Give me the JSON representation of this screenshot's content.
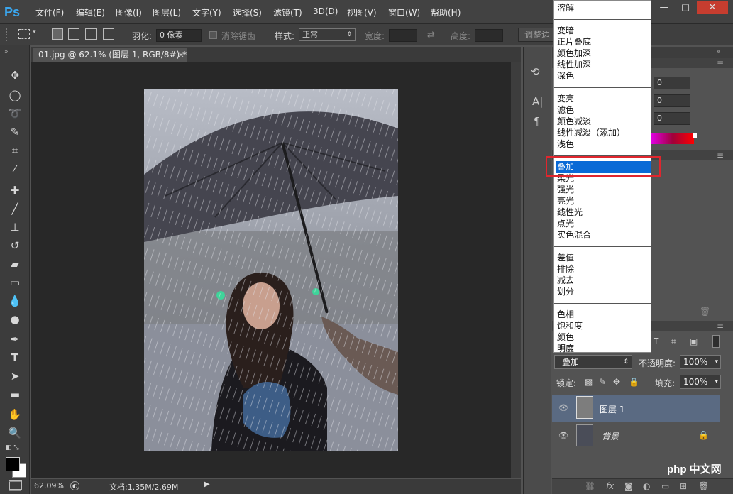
{
  "app": {
    "logo": "Ps"
  },
  "menu": [
    "文件(F)",
    "编辑(E)",
    "图像(I)",
    "图层(L)",
    "文字(Y)",
    "选择(S)",
    "滤镜(T)",
    "3D(D)",
    "视图(V)",
    "窗口(W)",
    "帮助(H)"
  ],
  "options": {
    "feather_label": "羽化:",
    "feather_value": "0 像素",
    "antialias_label": "消除锯齿",
    "style_label": "样式:",
    "style_value": "正常",
    "width_label": "宽度:",
    "height_label": "高度:",
    "refine_button": "调整边"
  },
  "document": {
    "tab_title": "01.jpg @ 62.1% (图层 1, RGB/8#) *",
    "tab_close": "×"
  },
  "status": {
    "zoom": "62.09%",
    "doc_info": "文档:1.35M/2.69M"
  },
  "properties": {
    "values": [
      "0",
      "0",
      "0"
    ]
  },
  "blend_dropdown": {
    "groups": [
      [
        "溶解"
      ],
      [
        "变暗",
        "正片叠底",
        "颜色加深",
        "线性加深",
        "深色"
      ],
      [
        "变亮",
        "滤色",
        "颜色减淡",
        "线性减淡（添加）",
        "浅色"
      ],
      [
        "叠加",
        "柔光",
        "强光",
        "亮光",
        "线性光",
        "点光",
        "实色混合"
      ],
      [
        "差值",
        "排除",
        "减去",
        "划分"
      ],
      [
        "色相",
        "饱和度",
        "颜色",
        "明度"
      ]
    ],
    "selected": "叠加"
  },
  "layers": {
    "blend_mode": "叠加",
    "opacity_label": "不透明度:",
    "opacity_value": "100%",
    "lock_label": "锁定:",
    "fill_label": "填充:",
    "fill_value": "100%",
    "items": [
      {
        "name": "图层 1",
        "selected": true
      },
      {
        "name": "背景",
        "selected": false
      }
    ]
  },
  "watermark": "php 中文网",
  "colors": {
    "accent": "#0a6ad6",
    "highlight_box": "#e0262e",
    "selected_layer": "#5a6a82"
  }
}
